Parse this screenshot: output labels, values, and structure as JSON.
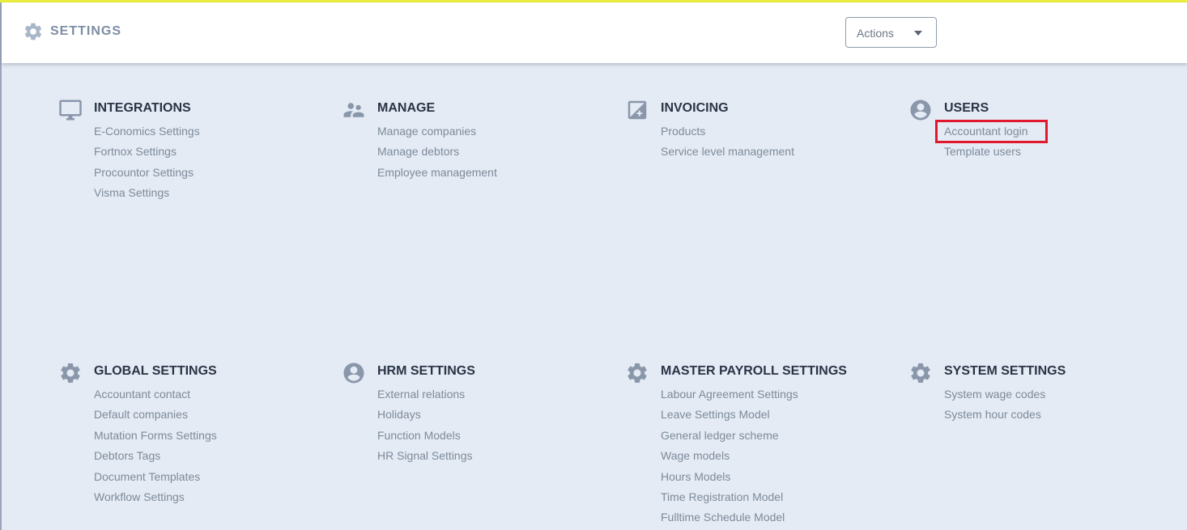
{
  "header": {
    "title": "SETTINGS",
    "icon": "gear-icon",
    "actions_label": "Actions"
  },
  "colors": {
    "accent_topline": "#e9ee3a",
    "background": "#e4ebf4",
    "icon": "#8a97ab",
    "link": "#7e8a9a",
    "title": "#2a3446",
    "highlight": "#e0192d"
  },
  "sections": [
    {
      "title": "INTEGRATIONS",
      "icon": "monitor-icon",
      "items": [
        "E-Conomics Settings",
        "Fortnox Settings",
        "Procountor Settings",
        "Visma Settings"
      ]
    },
    {
      "title": "MANAGE",
      "icon": "people-icon",
      "items": [
        "Manage companies",
        "Manage debtors",
        "Employee management"
      ]
    },
    {
      "title": "INVOICING",
      "icon": "invoice-icon",
      "items": [
        "Products",
        "Service level management"
      ]
    },
    {
      "title": "USERS",
      "icon": "user-circle-icon",
      "items": [
        "Accountant login",
        "Template users"
      ]
    },
    {
      "title": "GLOBAL SETTINGS",
      "icon": "gear-icon",
      "items": [
        "Accountant contact",
        "Default companies",
        "Mutation Forms Settings",
        "Debtors Tags",
        "Document Templates",
        "Workflow Settings"
      ]
    },
    {
      "title": "HRM SETTINGS",
      "icon": "user-circle-icon",
      "items": [
        "External relations",
        "Holidays",
        "Function Models",
        "HR Signal Settings"
      ]
    },
    {
      "title": "MASTER PAYROLL SETTINGS",
      "icon": "gear-icon",
      "items": [
        "Labour Agreement Settings",
        "Leave Settings Model",
        "General ledger scheme",
        "Wage models",
        "Hours Models",
        "Time Registration Model",
        "Fulltime Schedule Model"
      ]
    },
    {
      "title": "SYSTEM SETTINGS",
      "icon": "gear-icon",
      "items": [
        "System wage codes",
        "System hour codes"
      ]
    }
  ]
}
